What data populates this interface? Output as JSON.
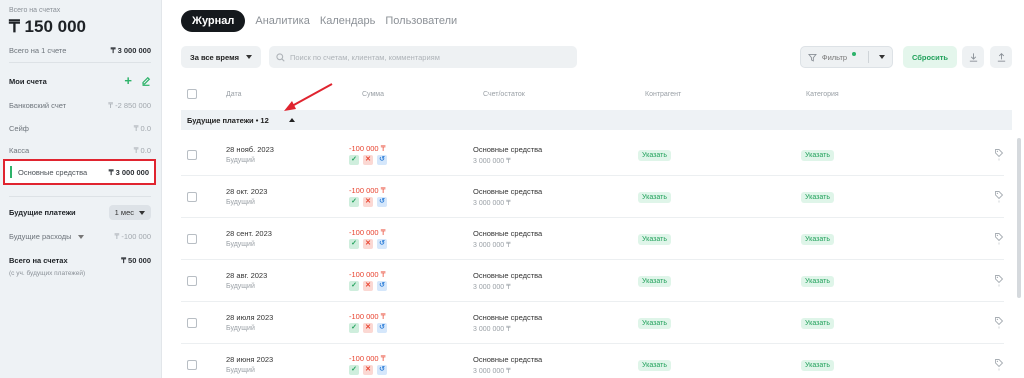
{
  "sidebar": {
    "caption": "Всего на счетах",
    "total": "₸ 150 000",
    "on_one_account_label": "Всего на 1 счете",
    "on_one_account_value": "₸ 3 000 000",
    "my_accounts_label": "Мои счета",
    "accounts": [
      {
        "label": "Банковский счет",
        "value": "₸ -2 850 000"
      },
      {
        "label": "Сейф",
        "value": "₸ 0.0"
      },
      {
        "label": "Касса",
        "value": "₸ 0.0"
      }
    ],
    "active_account": {
      "label": "Основные средства",
      "value": "₸ 3 000 000"
    },
    "future_payments_label": "Будущие платежи",
    "period_select": "1 мес",
    "future_expenses_label": "Будущие расходы",
    "future_expenses_value": "₸ -100 000",
    "total_on_accounts_label": "Всего на счетах",
    "total_on_accounts_value": "₸ 50 000",
    "total_note": "(с уч. будущих платежей)"
  },
  "tabs": [
    "Журнал",
    "Аналитика",
    "Календарь",
    "Пользователи"
  ],
  "toolbar": {
    "period": "За все время",
    "search_placeholder": "Поиск по счетам, клиентам, комментариям",
    "filter": "Фильтр",
    "reset": "Сбросить"
  },
  "table": {
    "headers": {
      "date": "Дата",
      "amount": "Сумма",
      "account": "Счет/остаток",
      "contractor": "Контрагент",
      "category": "Категория"
    },
    "group_label": "Будущие платежи • 12",
    "rows": [
      {
        "date": "28 нояб. 2023",
        "status": "Будущий",
        "amount": "-100 000 ₸",
        "account": "Основные средства",
        "balance": "3 000 000 ₸",
        "contractor": "Указать",
        "category": "Указать"
      },
      {
        "date": "28 окт. 2023",
        "status": "Будущий",
        "amount": "-100 000 ₸",
        "account": "Основные средства",
        "balance": "3 000 000 ₸",
        "contractor": "Указать",
        "category": "Указать"
      },
      {
        "date": "28 сент. 2023",
        "status": "Будущий",
        "amount": "-100 000 ₸",
        "account": "Основные средства",
        "balance": "3 000 000 ₸",
        "contractor": "Указать",
        "category": "Указать"
      },
      {
        "date": "28 авг. 2023",
        "status": "Будущий",
        "amount": "-100 000 ₸",
        "account": "Основные средства",
        "balance": "3 000 000 ₸",
        "contractor": "Указать",
        "category": "Указать"
      },
      {
        "date": "28 июля 2023",
        "status": "Будущий",
        "amount": "-100 000 ₸",
        "account": "Основные средства",
        "balance": "3 000 000 ₸",
        "contractor": "Указать",
        "category": "Указать"
      },
      {
        "date": "28 июня 2023",
        "status": "Будущий",
        "amount": "-100 000 ₸",
        "account": "Основные средства",
        "balance": "3 000 000 ₸",
        "contractor": "Указать",
        "category": "Указать"
      }
    ]
  },
  "colors": {
    "accent_green": "#2db36a",
    "negative": "#e8432f",
    "highlight_border": "#e0242f",
    "annotation_arrow": "#e0242f"
  }
}
